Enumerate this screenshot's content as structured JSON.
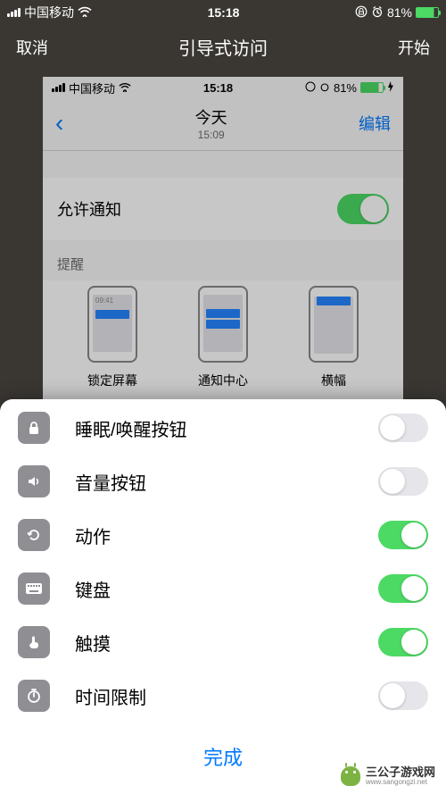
{
  "outer_status": {
    "carrier": "中国移动",
    "time": "15:18",
    "battery_pct": "81%"
  },
  "outer_nav": {
    "cancel": "取消",
    "title": "引导式访问",
    "start": "开始"
  },
  "inner_status": {
    "carrier": "中国移动",
    "time": "15:18",
    "battery_pct": "81%"
  },
  "inner_nav": {
    "title": "今天",
    "subtitle": "15:09",
    "edit": "编辑"
  },
  "notif": {
    "allow_label": "允许通知",
    "allow_on": true,
    "section_header": "提醒",
    "alerts": [
      {
        "label": "锁定屏幕",
        "time_in_icon": "09:41"
      },
      {
        "label": "通知中心"
      },
      {
        "label": "横幅"
      }
    ]
  },
  "sheet": {
    "items": [
      {
        "icon": "lock",
        "label": "睡眠/唤醒按钮",
        "on": false
      },
      {
        "icon": "volume",
        "label": "音量按钮",
        "on": false
      },
      {
        "icon": "motion",
        "label": "动作",
        "on": true
      },
      {
        "icon": "keyboard",
        "label": "键盘",
        "on": true
      },
      {
        "icon": "touch",
        "label": "触摸",
        "on": true
      },
      {
        "icon": "timer",
        "label": "时间限制",
        "on": false
      }
    ],
    "done": "完成"
  },
  "watermark": {
    "name": "三公子游戏网",
    "url": "www.sangongzi.net"
  },
  "colors": {
    "accent_blue": "#007aff",
    "accent_green": "#4cd964",
    "sheet_icon_bg": "#8e8e93"
  }
}
